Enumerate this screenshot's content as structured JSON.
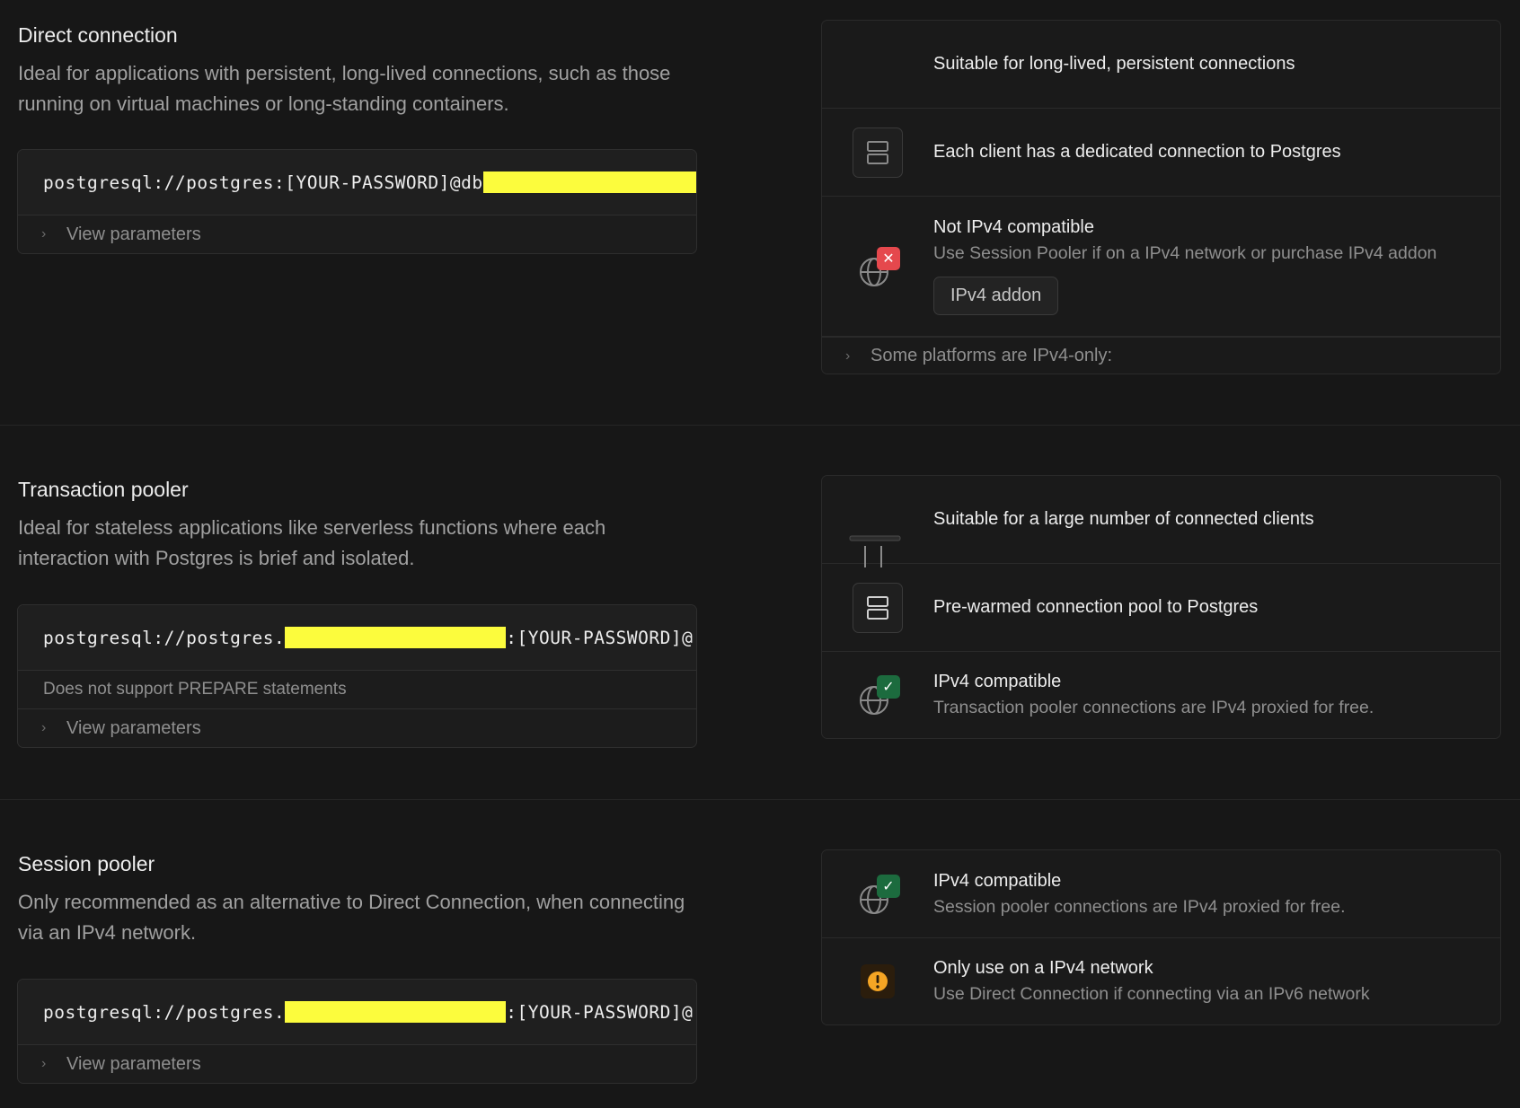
{
  "direct": {
    "title": "Direct connection",
    "description": "Ideal for applications with persistent, long-lived connections, such as those running on virtual machines or long-standing containers.",
    "connection_string": "postgresql://postgres:[YOUR-PASSWORD]@db",
    "view_parameters": "View parameters",
    "features": [
      {
        "title": "Suitable for long-lived, persistent connections"
      },
      {
        "title": "Each client has a dedicated connection to Postgres",
        "icon": "database-icon"
      },
      {
        "title": "Not IPv4 compatible",
        "subtitle": "Use Session Pooler if on a IPv4 network or purchase IPv4 addon",
        "icon": "globe-icon",
        "badge": "error-x-badge",
        "button": "IPv4 addon"
      }
    ],
    "footer": "Some platforms are IPv4-only:"
  },
  "transaction": {
    "title": "Transaction pooler",
    "description": "Ideal for stateless applications like serverless functions where each interaction with Postgres is brief and isolated.",
    "connection_prefix": "postgresql://postgres.",
    "connection_suffix": ":[YOUR-PASSWORD]@",
    "note": "Does not support PREPARE statements",
    "view_parameters": "View parameters",
    "features": [
      {
        "title": "Suitable for a large number of connected clients",
        "icon": "pooler-icon"
      },
      {
        "title": "Pre-warmed connection pool to Postgres",
        "icon": "database-icon"
      },
      {
        "title": "IPv4 compatible",
        "subtitle": "Transaction pooler connections are IPv4 proxied for free.",
        "icon": "globe-icon",
        "badge": "check-badge"
      }
    ]
  },
  "session": {
    "title": "Session pooler",
    "description": "Only recommended as an alternative to Direct Connection, when connecting via an IPv4 network.",
    "connection_prefix": "postgresql://postgres.",
    "connection_suffix": ":[YOUR-PASSWORD]@",
    "view_parameters": "View parameters",
    "features": [
      {
        "title": "IPv4 compatible",
        "subtitle": "Session pooler connections are IPv4 proxied for free.",
        "icon": "globe-icon",
        "badge": "check-badge"
      },
      {
        "title": "Only use on a IPv4 network",
        "subtitle": "Use Direct Connection if connecting via an IPv6 network",
        "icon": "warning-icon"
      }
    ]
  },
  "colors": {
    "background": "#171717",
    "redaction": "#fcfc3d",
    "error": "#e5484d",
    "success": "#1c6b3e",
    "warning": "#f5a524"
  }
}
